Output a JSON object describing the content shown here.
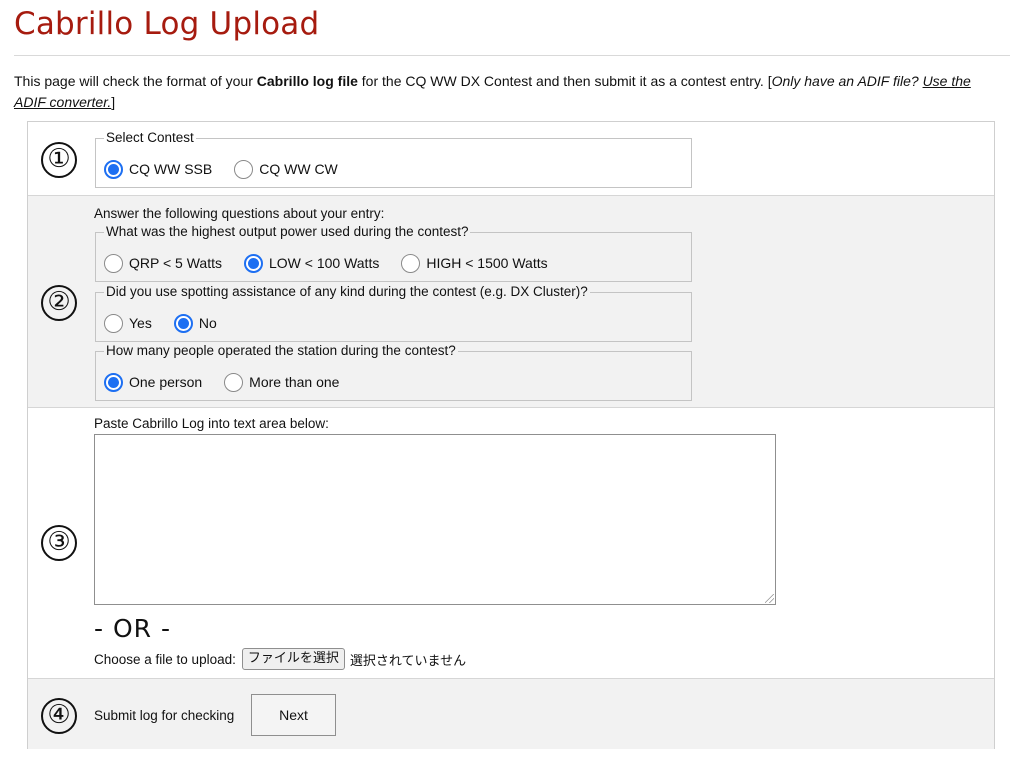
{
  "page": {
    "title": "Cabrillo Log Upload",
    "intro": {
      "before_bold": "This page will check the format of your ",
      "bold": "Cabrillo log file",
      "after_bold": " for the CQ WW DX Contest and then submit it as a contest entry. [",
      "italic": "Only have an ADIF file? ",
      "link": "Use the ADIF converter.",
      "closing": "]"
    }
  },
  "steps": {
    "step1": {
      "number": "①",
      "legend": "Select Contest",
      "options": [
        {
          "label": "CQ WW SSB",
          "checked": true
        },
        {
          "label": "CQ WW CW",
          "checked": false
        }
      ]
    },
    "step2": {
      "number": "②",
      "heading": "Answer the following questions about your entry:",
      "power": {
        "legend": "What was the highest output power used during the contest?",
        "options": [
          {
            "label": "QRP < 5 Watts",
            "checked": false
          },
          {
            "label": "LOW < 100 Watts",
            "checked": true
          },
          {
            "label": "HIGH < 1500 Watts",
            "checked": false
          }
        ]
      },
      "assist": {
        "legend": "Did you use spotting assistance of any kind during the contest (e.g. DX Cluster)?",
        "options": [
          {
            "label": "Yes",
            "checked": false
          },
          {
            "label": "No",
            "checked": true
          }
        ]
      },
      "operators": {
        "legend": "How many people operated the station during the contest?",
        "options": [
          {
            "label": "One person",
            "checked": true
          },
          {
            "label": "More than one",
            "checked": false
          }
        ]
      }
    },
    "step3": {
      "number": "③",
      "paste_label": "Paste Cabrillo Log into text area below:",
      "textarea_value": "",
      "or_text": "- OR -",
      "file_label": "Choose a file to upload:",
      "file_button": "ファイルを選択",
      "file_status": "選択されていません"
    },
    "step4": {
      "number": "④",
      "label": "Submit log for checking",
      "button": "Next"
    }
  },
  "colors": {
    "title": "#a61b0f",
    "radio_accent": "#1d6ff2",
    "gray_band": "#f2f2f2"
  }
}
